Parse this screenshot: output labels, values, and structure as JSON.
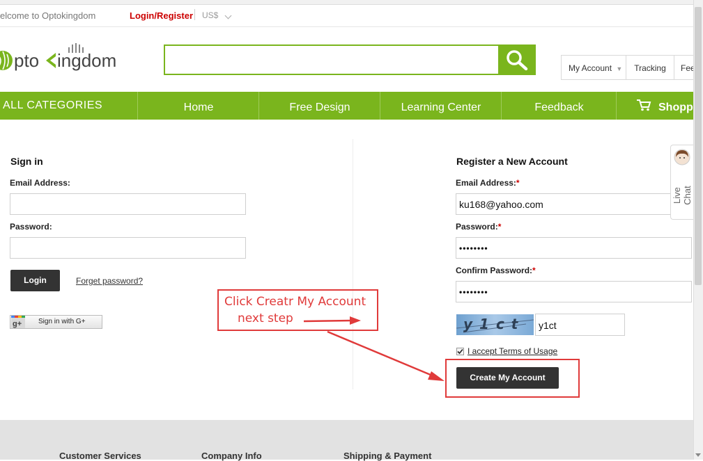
{
  "topbar": {
    "welcome": "elcome to Optokingdom",
    "login_register": "Login/Register",
    "currency": "US$"
  },
  "brand": {
    "logo_text": "ptoKingdom"
  },
  "search": {
    "placeholder": ""
  },
  "account_tabs": [
    "My Account",
    "Tracking",
    "Fee"
  ],
  "nav": {
    "all_categories": "ALL CATEGORIES",
    "items": [
      "Home",
      "Free Design",
      "Learning Center",
      "Feedback"
    ],
    "cart": "Shoppi"
  },
  "signin": {
    "title": "Sign in",
    "email_label": "Email Address:",
    "password_label": "Password:",
    "login_button": "Login",
    "forget_link": "Forget password?",
    "google_button": "Sign in with G+"
  },
  "register": {
    "title": "Register a New Account",
    "email_label": "Email Address:",
    "email_value": "ku168@yahoo.com",
    "password_label": "Password:",
    "password_value": "••••••••",
    "confirm_label": "Confirm Password:",
    "confirm_value": "••••••••",
    "captcha_text": "y1ct",
    "captcha_value": "y1ct",
    "terms_label": "I accept Terms of Usage",
    "create_button": "Create My Account",
    "required_mark": "*"
  },
  "annotation": {
    "line1": "Click Creatr My Account",
    "line2": "next step"
  },
  "live_chat": "Live Chat",
  "footer": [
    "Customer Services",
    "Company Info",
    "Shipping & Payment"
  ],
  "colors": {
    "brand_green": "#7ab51d",
    "annotation_red": "#e03a3a",
    "link_red": "#cc0000"
  }
}
